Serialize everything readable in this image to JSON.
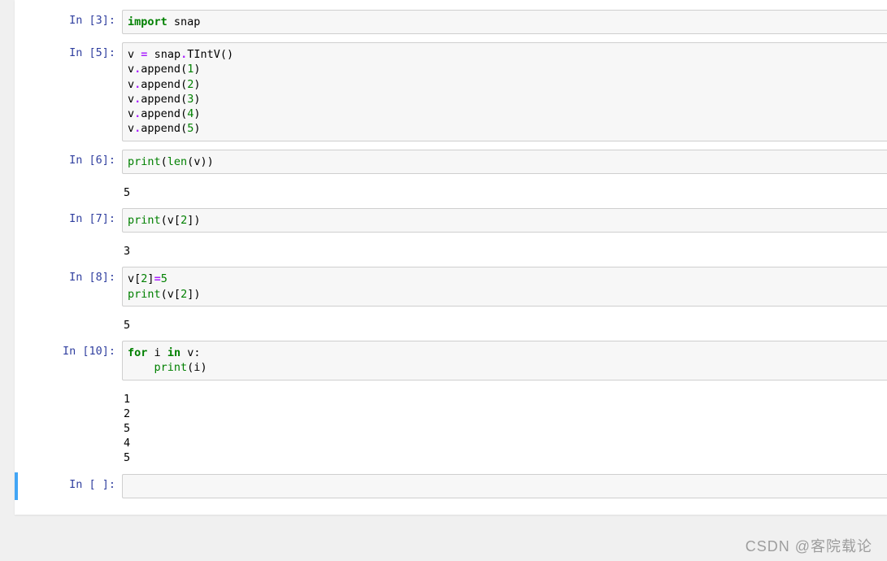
{
  "watermark": "CSDN @客院载论",
  "cells": [
    {
      "prompt": "In [3]:",
      "code_html": "<span class='kw'>import</span> <span class='nm'>snap</span>",
      "output": null,
      "selected": false
    },
    {
      "prompt": "In [5]:",
      "code_html": "<span class='nm'>v</span> <span class='op'>=</span> <span class='nm'>snap</span><span class='op'>.</span><span class='nm'>TIntV</span><span class='pun'>()</span>\n<span class='nm'>v</span><span class='op'>.</span><span class='nm'>append</span><span class='pun'>(</span><span class='num'>1</span><span class='pun'>)</span>\n<span class='nm'>v</span><span class='op'>.</span><span class='nm'>append</span><span class='pun'>(</span><span class='num'>2</span><span class='pun'>)</span>\n<span class='nm'>v</span><span class='op'>.</span><span class='nm'>append</span><span class='pun'>(</span><span class='num'>3</span><span class='pun'>)</span>\n<span class='nm'>v</span><span class='op'>.</span><span class='nm'>append</span><span class='pun'>(</span><span class='num'>4</span><span class='pun'>)</span>\n<span class='nm'>v</span><span class='op'>.</span><span class='nm'>append</span><span class='pun'>(</span><span class='num'>5</span><span class='pun'>)</span>",
      "output": null,
      "selected": false
    },
    {
      "prompt": "In [6]:",
      "code_html": "<span class='bi'>print</span><span class='pun'>(</span><span class='bi'>len</span><span class='pun'>(</span><span class='nm'>v</span><span class='pun'>))</span>",
      "output": "5",
      "selected": false
    },
    {
      "prompt": "In [7]:",
      "code_html": "<span class='bi'>print</span><span class='pun'>(</span><span class='nm'>v</span><span class='pun'>[</span><span class='num'>2</span><span class='pun'>])</span>",
      "output": "3",
      "selected": false
    },
    {
      "prompt": "In [8]:",
      "code_html": "<span class='nm'>v</span><span class='pun'>[</span><span class='num'>2</span><span class='pun'>]</span><span class='op'>=</span><span class='num'>5</span>\n<span class='bi'>print</span><span class='pun'>(</span><span class='nm'>v</span><span class='pun'>[</span><span class='num'>2</span><span class='pun'>])</span>",
      "output": "5",
      "selected": false
    },
    {
      "prompt": "In [10]:",
      "code_html": "<span class='kw'>for</span> <span class='nm'>i</span> <span class='kw'>in</span> <span class='nm'>v</span><span class='pun'>:</span>\n    <span class='bi'>print</span><span class='pun'>(</span><span class='nm'>i</span><span class='pun'>)</span>",
      "output": "1\n2\n5\n4\n5",
      "selected": false
    },
    {
      "prompt": "In [ ]:",
      "code_html": " ",
      "output": null,
      "selected": true
    }
  ]
}
